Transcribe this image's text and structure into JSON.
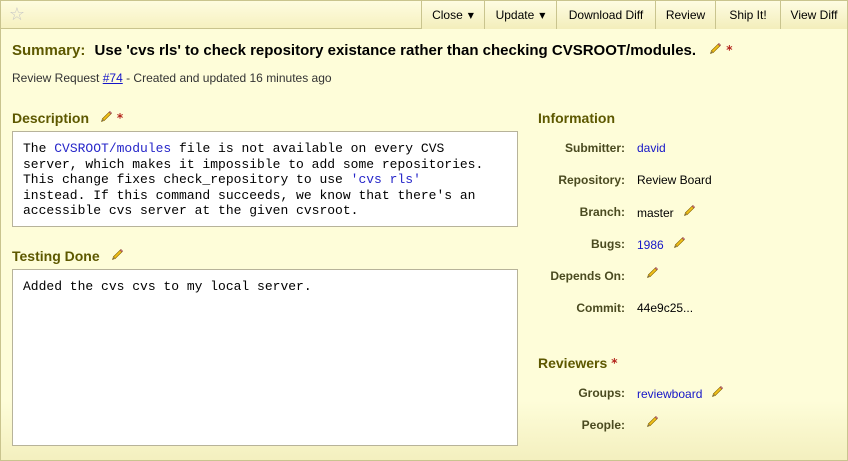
{
  "toolbar": {
    "star_icon": "star-icon",
    "actions": [
      {
        "label": "Close",
        "dropdown": true
      },
      {
        "label": "Update",
        "dropdown": true
      },
      {
        "label": "Download Diff",
        "dropdown": false
      },
      {
        "label": "Review",
        "dropdown": false
      },
      {
        "label": "Ship It!",
        "dropdown": false
      },
      {
        "label": "View Diff",
        "dropdown": false
      }
    ]
  },
  "summary": {
    "label": "Summary:",
    "text": "Use 'cvs rls' to check repository existance rather than checking CVSROOT/modules."
  },
  "subline": {
    "prefix": "Review Request ",
    "link": "#74",
    "suffix": " - Created and updated 16 minutes ago"
  },
  "description": {
    "title": "Description",
    "segments": [
      "The ",
      "CVSROOT/modules",
      " file is not available on every CVS\nserver, which makes it impossible to add some repositories.\nThis change fixes check_repository to use ",
      "'cvs rls'",
      "\ninstead. If this command succeeds, we know that there's an\naccessible cvs server at the given cvsroot."
    ]
  },
  "testing": {
    "title": "Testing Done",
    "text": "Added the cvs cvs to my local server."
  },
  "information": {
    "title": "Information",
    "submitter_label": "Submitter:",
    "submitter": "david",
    "repository_label": "Repository:",
    "repository": "Review Board",
    "branch_label": "Branch:",
    "branch": "master",
    "bugs_label": "Bugs:",
    "bugs": "1986",
    "depends_label": "Depends On:",
    "depends": "",
    "commit_label": "Commit:",
    "commit": "44e9c25..."
  },
  "reviewers": {
    "title": "Reviewers",
    "groups_label": "Groups:",
    "groups": "reviewboard",
    "people_label": "People:",
    "people": ""
  },
  "colors": {
    "background": "#fefcd9",
    "heading": "#5d5800",
    "link": "#1515c8",
    "required": "#b3231b"
  }
}
